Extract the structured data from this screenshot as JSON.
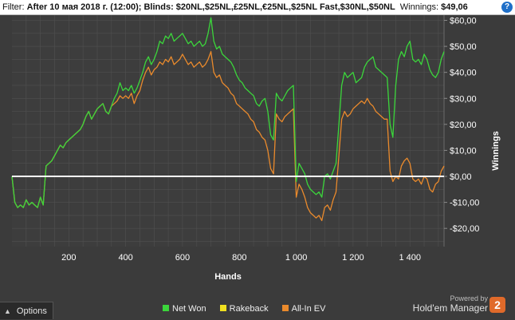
{
  "filter": {
    "label": "Filter:",
    "value": "After 10 мая 2018 г. (12:00); Blinds: $20NL,$25NL,£25NL,€25NL,$25NL Fast,$30NL,$50NL",
    "winnings_label": "Winnings:",
    "winnings_value": "$49,06",
    "help_icon": "?"
  },
  "bottom": {
    "options_label": "Options",
    "options_icon": "chevron-up-icon",
    "powered_by": "Powered by",
    "brand": "Hold'em Manager",
    "brand_logo_text": "2"
  },
  "colors": {
    "net_won": "#3bd63b",
    "rakeback": "#f0e020",
    "all_in_ev": "#ea8a2c",
    "zero_line": "#ffffff",
    "plot_bg": "#3d3d3d",
    "grid": "#505050"
  },
  "chart_data": {
    "type": "line",
    "xlabel": "Hands",
    "ylabel": "Winnings",
    "xlim": [
      0,
      1520
    ],
    "ylim": [
      -27,
      62
    ],
    "x_ticks": [
      200,
      400,
      600,
      800,
      1000,
      1200,
      1400
    ],
    "x_tick_labels": [
      "200",
      "400",
      "600",
      "800",
      "1 000",
      "1 200",
      "1 400"
    ],
    "y_ticks": [
      60,
      50,
      40,
      30,
      20,
      10,
      0,
      -10,
      -20
    ],
    "y_tick_labels": [
      "$60,00",
      "$50,00",
      "$40,00",
      "$30,00",
      "$20,00",
      "$10,00",
      "$0,00",
      "-$10,00",
      "-$20,00"
    ],
    "grid": true,
    "legend": "bottom",
    "series": [
      {
        "name": "Net Won",
        "color_key": "net_won",
        "x": [
          0,
          10,
          20,
          30,
          40,
          50,
          60,
          70,
          80,
          90,
          100,
          110,
          120,
          130,
          140,
          150,
          160,
          170,
          180,
          190,
          200,
          210,
          220,
          230,
          240,
          250,
          260,
          270,
          280,
          290,
          300,
          310,
          320,
          330,
          340,
          350,
          360,
          370,
          380,
          390,
          400,
          410,
          420,
          430,
          440,
          450,
          460,
          470,
          480,
          490,
          500,
          510,
          520,
          530,
          540,
          550,
          560,
          570,
          580,
          590,
          600,
          610,
          620,
          630,
          640,
          650,
          660,
          670,
          680,
          690,
          700,
          710,
          720,
          730,
          740,
          750,
          760,
          770,
          780,
          790,
          800,
          810,
          820,
          830,
          840,
          850,
          860,
          870,
          880,
          890,
          900,
          910,
          920,
          930,
          940,
          950,
          960,
          970,
          980,
          990,
          1000,
          1010,
          1020,
          1030,
          1040,
          1050,
          1060,
          1070,
          1080,
          1090,
          1100,
          1110,
          1120,
          1130,
          1140,
          1150,
          1160,
          1170,
          1180,
          1190,
          1200,
          1210,
          1220,
          1230,
          1240,
          1250,
          1260,
          1270,
          1280,
          1290,
          1300,
          1310,
          1320,
          1330,
          1340,
          1350,
          1360,
          1370,
          1380,
          1390,
          1400,
          1410,
          1420,
          1430,
          1440,
          1450,
          1460,
          1470,
          1480,
          1490,
          1500,
          1510,
          1520
        ],
        "values": [
          0,
          -10,
          -12,
          -11,
          -12,
          -9,
          -11,
          -10,
          -11,
          -12,
          -8,
          -11,
          4,
          5,
          6,
          8,
          10,
          12,
          11,
          13,
          14,
          15,
          16,
          17,
          18,
          20,
          23,
          25,
          22,
          24,
          26,
          27,
          28,
          25,
          24,
          27,
          30,
          32,
          36,
          33,
          34,
          33,
          35,
          32,
          34,
          37,
          40,
          44,
          46,
          43,
          45,
          48,
          52,
          51,
          54,
          53,
          55,
          52,
          53,
          54,
          55,
          53,
          51,
          52,
          50,
          51,
          52,
          50,
          51,
          55,
          61,
          52,
          49,
          50,
          47,
          46,
          45,
          44,
          42,
          39,
          37,
          36,
          34,
          33,
          32,
          31,
          28,
          27,
          29,
          30,
          25,
          16,
          14,
          32,
          30,
          29,
          31,
          33,
          34,
          35,
          -2,
          5,
          3,
          1,
          -3,
          -5,
          -6,
          -7,
          -6,
          -8,
          0,
          1,
          -1,
          2,
          5,
          20,
          35,
          40,
          38,
          39,
          40,
          36,
          37,
          38,
          42,
          44,
          45,
          46,
          42,
          41,
          40,
          39,
          38,
          20,
          15,
          35,
          45,
          48,
          46,
          50,
          52,
          45,
          44,
          45,
          43,
          47,
          45,
          41,
          39,
          38,
          40,
          45,
          48
        ]
      },
      {
        "name": "Rakeback",
        "color_key": "rakeback",
        "x": [
          0,
          1520
        ],
        "values": [
          0,
          0
        ]
      },
      {
        "name": "All-In EV",
        "color_key": "all_in_ev",
        "x": [
          0,
          10,
          20,
          30,
          40,
          50,
          60,
          70,
          80,
          90,
          100,
          110,
          120,
          130,
          140,
          150,
          160,
          170,
          180,
          190,
          200,
          210,
          220,
          230,
          240,
          250,
          260,
          270,
          280,
          290,
          300,
          310,
          320,
          330,
          340,
          350,
          360,
          370,
          380,
          390,
          400,
          410,
          420,
          430,
          440,
          450,
          460,
          470,
          480,
          490,
          500,
          510,
          520,
          530,
          540,
          550,
          560,
          570,
          580,
          590,
          600,
          610,
          620,
          630,
          640,
          650,
          660,
          670,
          680,
          690,
          700,
          710,
          720,
          730,
          740,
          750,
          760,
          770,
          780,
          790,
          800,
          810,
          820,
          830,
          840,
          850,
          860,
          870,
          880,
          890,
          900,
          910,
          920,
          930,
          940,
          950,
          960,
          970,
          980,
          990,
          1000,
          1010,
          1020,
          1030,
          1040,
          1050,
          1060,
          1070,
          1080,
          1090,
          1100,
          1110,
          1120,
          1130,
          1140,
          1150,
          1160,
          1170,
          1180,
          1190,
          1200,
          1210,
          1220,
          1230,
          1240,
          1250,
          1260,
          1270,
          1280,
          1290,
          1300,
          1310,
          1320,
          1330,
          1340,
          1350,
          1360,
          1370,
          1380,
          1390,
          1400,
          1410,
          1420,
          1430,
          1440,
          1450,
          1460,
          1470,
          1480,
          1490,
          1500,
          1510,
          1520
        ],
        "values": [
          0,
          -10,
          -12,
          -11,
          -12,
          -9,
          -11,
          -10,
          -11,
          -12,
          -8,
          -11,
          4,
          5,
          6,
          8,
          10,
          12,
          11,
          13,
          14,
          15,
          16,
          17,
          18,
          20,
          23,
          25,
          22,
          24,
          26,
          27,
          28,
          25,
          24,
          27,
          28,
          29,
          31,
          30,
          31,
          30,
          32,
          28,
          31,
          33,
          37,
          40,
          42,
          39,
          41,
          42,
          44,
          43,
          45,
          44,
          46,
          43,
          44,
          45,
          47,
          45,
          43,
          44,
          42,
          43,
          44,
          42,
          43,
          45,
          48,
          40,
          38,
          39,
          36,
          35,
          34,
          32,
          31,
          28,
          27,
          26,
          25,
          24,
          22,
          21,
          18,
          17,
          15,
          14,
          10,
          3,
          1,
          24,
          22,
          21,
          23,
          24,
          25,
          26,
          -8,
          -3,
          -5,
          -8,
          -12,
          -14,
          -15,
          -16,
          -15,
          -17,
          -12,
          -11,
          -13,
          -9,
          -6,
          8,
          22,
          25,
          23,
          24,
          26,
          27,
          28,
          29,
          28,
          30,
          28,
          27,
          25,
          24,
          23,
          22,
          22,
          2,
          -2,
          0,
          -1,
          4,
          6,
          7,
          5,
          -1,
          -2,
          -1,
          -3,
          0,
          -1,
          -5,
          -6,
          -3,
          -2,
          2,
          4
        ]
      }
    ]
  }
}
